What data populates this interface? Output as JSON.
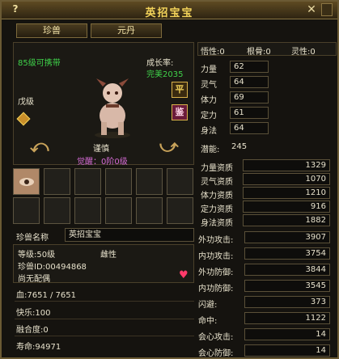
{
  "window": {
    "title": "英招宝宝",
    "help": "?",
    "close": "✕"
  },
  "tabs": [
    "珍兽",
    "元丹"
  ],
  "pet": {
    "level_text": "85级可携带",
    "growth_label": "成长率:",
    "growth_value": "完美2035",
    "grade": "戊级",
    "temper": "谨慎",
    "awaken": "觉醒：0阶0级",
    "btn_ping": "平",
    "btn_jian": "鉴"
  },
  "aptitude_top": {
    "wuxing": "悟性:0",
    "gengu": "根骨:0",
    "lingxing": "灵性:0"
  },
  "attrs": [
    {
      "label": "力量",
      "value": "62"
    },
    {
      "label": "灵气",
      "value": "64"
    },
    {
      "label": "体力",
      "value": "69"
    },
    {
      "label": "定力",
      "value": "61"
    },
    {
      "label": "身法",
      "value": "64"
    }
  ],
  "potential": {
    "label": "潜能:",
    "value": "245"
  },
  "talents": [
    {
      "label": "力量资质",
      "value": "1329"
    },
    {
      "label": "灵气资质",
      "value": "1070"
    },
    {
      "label": "体力资质",
      "value": "1210"
    },
    {
      "label": "定力资质",
      "value": "916"
    },
    {
      "label": "身法资质",
      "value": "1882"
    }
  ],
  "name_row": {
    "label": "珍兽名称",
    "value": "英招宝宝"
  },
  "info": {
    "level": "等级:50级",
    "gender": "雌性",
    "id": "珍兽ID:00494868",
    "mate": "尚无配偶",
    "hp": "血:7651 / 7651",
    "happy": "快乐:100",
    "fusion": "融合度:0",
    "life": "寿命:94971"
  },
  "combat": [
    {
      "label": "外功攻击:",
      "value": "3907"
    },
    {
      "label": "内功攻击:",
      "value": "3754"
    },
    {
      "label": "外功防御:",
      "value": "3844"
    },
    {
      "label": "内功防御:",
      "value": "3545"
    },
    {
      "label": "闪避:",
      "value": "373"
    },
    {
      "label": "命中:",
      "value": "1122"
    },
    {
      "label": "会心攻击:",
      "value": "14"
    },
    {
      "label": "会心防御:",
      "value": "14"
    }
  ],
  "colors": {
    "green": "#3fd24a",
    "gold": "#f3d35a",
    "purple": "#d46ad4"
  }
}
